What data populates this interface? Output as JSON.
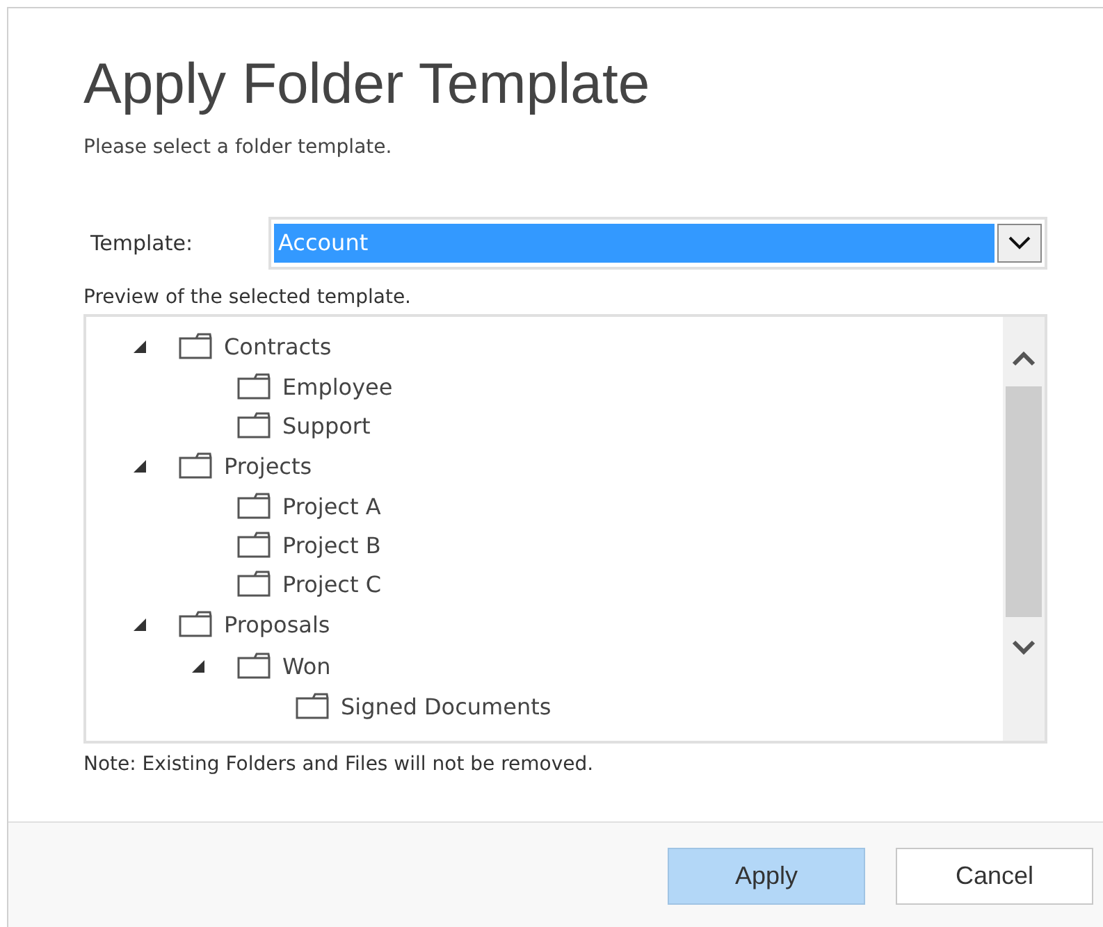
{
  "dialog": {
    "title": "Apply Folder Template",
    "subtitle": "Please select a folder template."
  },
  "template": {
    "label": "Template:",
    "value": "Account"
  },
  "preview": {
    "label": "Preview of the selected template.",
    "tree": [
      {
        "label": "Contracts",
        "expanded": true,
        "children": [
          {
            "label": "Employee"
          },
          {
            "label": "Support"
          }
        ]
      },
      {
        "label": "Projects",
        "expanded": true,
        "children": [
          {
            "label": "Project A"
          },
          {
            "label": "Project B"
          },
          {
            "label": "Project C"
          }
        ]
      },
      {
        "label": "Proposals",
        "expanded": true,
        "children": [
          {
            "label": "Won",
            "expanded": true,
            "children": [
              {
                "label": "Signed Documents"
              }
            ]
          }
        ]
      }
    ]
  },
  "note": "Note: Existing Folders and Files will not be removed.",
  "buttons": [
    {
      "label": "Apply",
      "primary": true
    },
    {
      "label": "Cancel",
      "primary": false
    }
  ]
}
